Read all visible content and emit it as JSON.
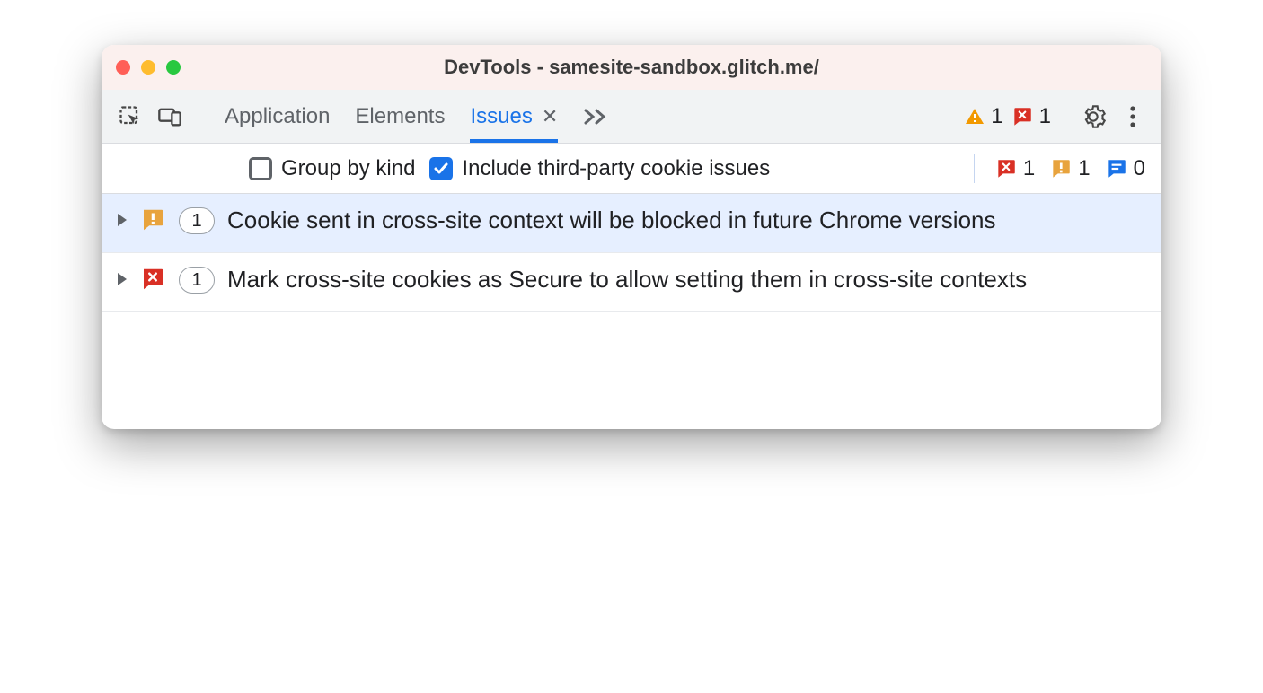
{
  "window": {
    "title": "DevTools - samesite-sandbox.glitch.me/"
  },
  "mainbar": {
    "tabs": [
      {
        "label": "Application",
        "active": false
      },
      {
        "label": "Elements",
        "active": false
      },
      {
        "label": "Issues",
        "active": true
      }
    ],
    "warning_count": "1",
    "error_count": "1"
  },
  "subbar": {
    "group_by_kind_label": "Group by kind",
    "group_by_kind_checked": false,
    "include_tp_label": "Include third-party cookie issues",
    "include_tp_checked": true,
    "summary": {
      "errors": "1",
      "warnings": "1",
      "info": "0"
    }
  },
  "issues": [
    {
      "severity": "warning",
      "count": "1",
      "title": "Cookie sent in cross-site context will be blocked in future Chrome versions",
      "selected": true
    },
    {
      "severity": "error",
      "count": "1",
      "title": "Mark cross-site cookies as Secure to allow setting them in cross-site contexts",
      "selected": false
    }
  ]
}
